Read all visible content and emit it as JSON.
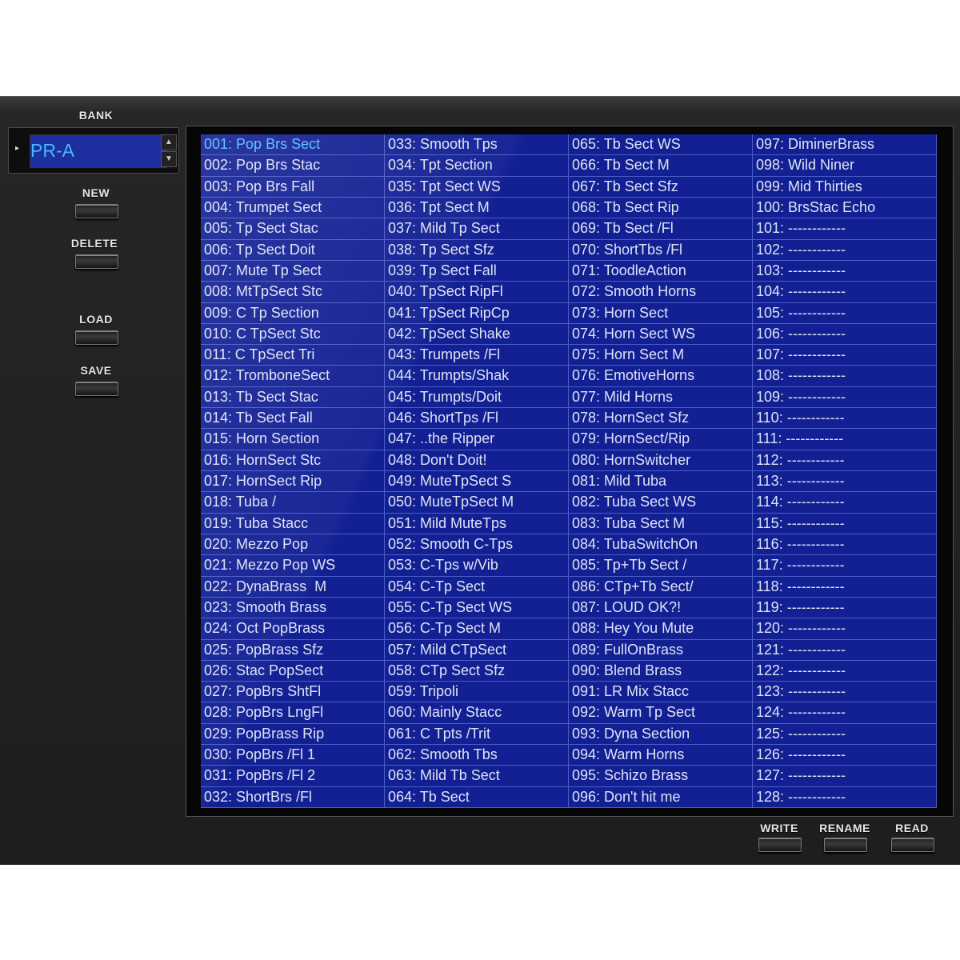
{
  "bank": {
    "label": "BANK",
    "value": "PR-A",
    "up_glyph": "▲",
    "down_glyph": "▼",
    "arrow_glyph": "▸"
  },
  "left_buttons": {
    "new": "NEW",
    "delete": "DELETE",
    "load": "LOAD",
    "save": "SAVE"
  },
  "bottom_buttons": {
    "write": "WRITE",
    "rename": "RENAME",
    "read": "READ"
  },
  "selected_index": 0,
  "patches": [
    "001: Pop Brs Sect",
    "002: Pop Brs Stac",
    "003: Pop Brs Fall",
    "004: Trumpet Sect",
    "005: Tp Sect Stac",
    "006: Tp Sect Doit",
    "007: Mute Tp Sect",
    "008: MtTpSect Stc",
    "009: C Tp Section",
    "010: C TpSect Stc",
    "011: C TpSect Tri",
    "012: TromboneSect",
    "013: Tb Sect Stac",
    "014: Tb Sect Fall",
    "015: Horn Section",
    "016: HornSect Stc",
    "017: HornSect Rip",
    "018: Tuba /",
    "019: Tuba Stacc",
    "020: Mezzo Pop",
    "021: Mezzo Pop WS",
    "022: DynaBrass  M",
    "023: Smooth Brass",
    "024: Oct PopBrass",
    "025: PopBrass Sfz",
    "026: Stac PopSect",
    "027: PopBrs ShtFl",
    "028: PopBrs LngFl",
    "029: PopBrass Rip",
    "030: PopBrs /Fl 1",
    "031: PopBrs /Fl 2",
    "032: ShortBrs /Fl",
    "033: Smooth Tps",
    "034: Tpt Section",
    "035: Tpt Sect WS",
    "036: Tpt Sect M",
    "037: Mild Tp Sect",
    "038: Tp Sect Sfz",
    "039: Tp Sect Fall",
    "040: TpSect RipFl",
    "041: TpSect RipCp",
    "042: TpSect Shake",
    "043: Trumpets /Fl",
    "044: Trumpts/Shak",
    "045: Trumpts/Doit",
    "046: ShortTps /Fl",
    "047: ..the Ripper",
    "048: Don't Doit!",
    "049: MuteTpSect S",
    "050: MuteTpSect M",
    "051: Mild MuteTps",
    "052: Smooth C-Tps",
    "053: C-Tps w/Vib",
    "054: C-Tp Sect",
    "055: C-Tp Sect WS",
    "056: C-Tp Sect M",
    "057: Mild CTpSect",
    "058: CTp Sect Sfz",
    "059: Tripoli",
    "060: Mainly Stacc",
    "061: C Tpts /Trit",
    "062: Smooth Tbs",
    "063: Mild Tb Sect",
    "064: Tb Sect",
    "065: Tb Sect WS",
    "066: Tb Sect M",
    "067: Tb Sect Sfz",
    "068: Tb Sect Rip",
    "069: Tb Sect /Fl",
    "070: ShortTbs /Fl",
    "071: ToodleAction",
    "072: Smooth Horns",
    "073: Horn Sect",
    "074: Horn Sect WS",
    "075: Horn Sect M",
    "076: EmotiveHorns",
    "077: Mild Horns",
    "078: HornSect Sfz",
    "079: HornSect/Rip",
    "080: HornSwitcher",
    "081: Mild Tuba",
    "082: Tuba Sect WS",
    "083: Tuba Sect M",
    "084: TubaSwitchOn",
    "085: Tp+Tb Sect /",
    "086: CTp+Tb Sect/",
    "087: LOUD OK?!",
    "088: Hey You Mute",
    "089: FullOnBrass",
    "090: Blend Brass",
    "091: LR Mix Stacc",
    "092: Warm Tp Sect",
    "093: Dyna Section",
    "094: Warm Horns",
    "095: Schizo Brass",
    "096: Don't hit me",
    "097: DiminerBrass",
    "098: Wild Niner",
    "099: Mid Thirties",
    "100: BrsStac Echo",
    "101: ------------",
    "102: ------------",
    "103: ------------",
    "104: ------------",
    "105: ------------",
    "106: ------------",
    "107: ------------",
    "108: ------------",
    "109: ------------",
    "110: ------------",
    "111: ------------",
    "112: ------------",
    "113: ------------",
    "114: ------------",
    "115: ------------",
    "116: ------------",
    "117: ------------",
    "118: ------------",
    "119: ------------",
    "120: ------------",
    "121: ------------",
    "122: ------------",
    "123: ------------",
    "124: ------------",
    "125: ------------",
    "126: ------------",
    "127: ------------",
    "128: ------------"
  ]
}
